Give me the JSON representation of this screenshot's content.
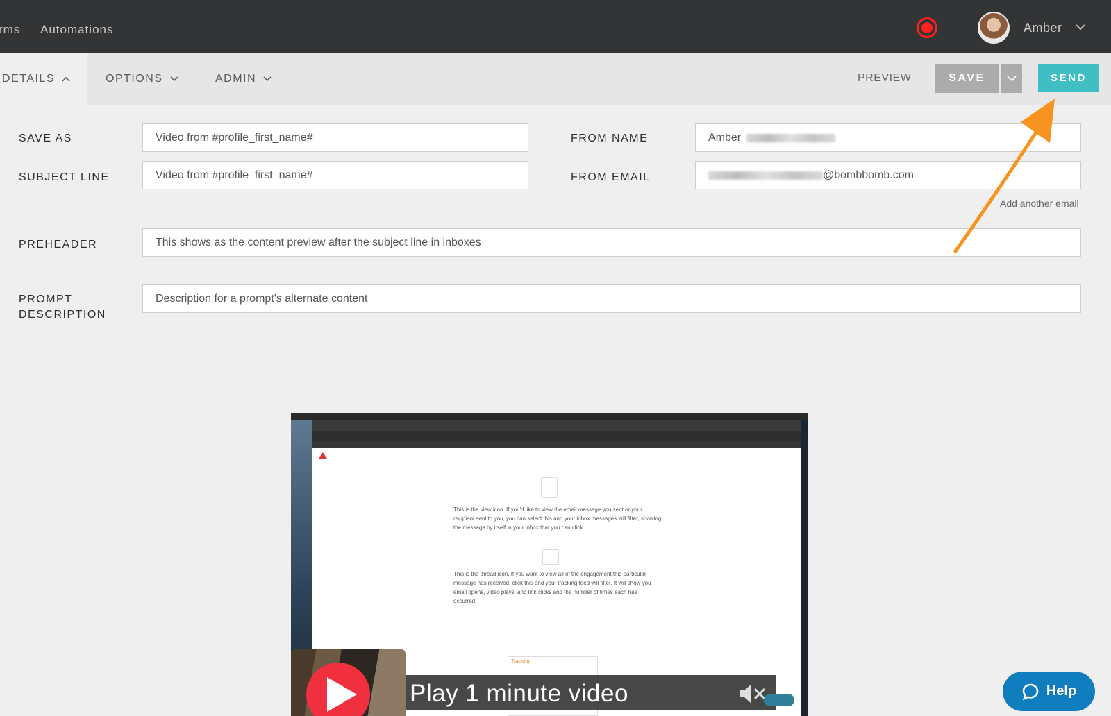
{
  "topnav": {
    "forms_label": "rms",
    "automations_label": "Automations"
  },
  "user": {
    "name": "Amber"
  },
  "tabs": {
    "details": "DETAILS",
    "options": "OPTIONS",
    "admin": "ADMIN"
  },
  "actions": {
    "preview": "PREVIEW",
    "save": "SAVE",
    "send": "SEND"
  },
  "form": {
    "save_as": {
      "label": "SAVE AS",
      "value": "Video from #profile_first_name#"
    },
    "subject_line": {
      "label": "SUBJECT LINE",
      "value": "Video from #profile_first_name#"
    },
    "from_name": {
      "label": "FROM NAME",
      "value": "Amber"
    },
    "from_email": {
      "label": "FROM EMAIL",
      "value_suffix": "@bombbomb.com"
    },
    "add_another_email": "Add another email",
    "preheader": {
      "label": "PREHEADER",
      "placeholder": "This shows as the content preview after the subject line in inboxes"
    },
    "prompt_description": {
      "label_line1": "PROMPT",
      "label_line2": "DESCRIPTION",
      "placeholder": "Description for a prompt's alternate content"
    }
  },
  "video": {
    "play_title": "Play 1 minute video",
    "page_text_1": "This is the view icon. If you'd like to view the email message you sent or your recipient sent to you, you can select this and your inbox messages will filter, showing the message by itself in your inbox that you can click.",
    "page_text_2": "This is the thread icon. If you want to view all of the engagement this particular message has received, click this and your tracking feed will filter. It will show you email opens, video plays, and link clicks and the number of times each has occurred.",
    "tracking_label": "Tracking"
  },
  "help": {
    "label": "Help"
  },
  "colors": {
    "send": "#3fbfc4",
    "help": "#0f7dbe",
    "record": "#ff2020",
    "arrow": "#f7931e",
    "play": "#f0303f"
  }
}
